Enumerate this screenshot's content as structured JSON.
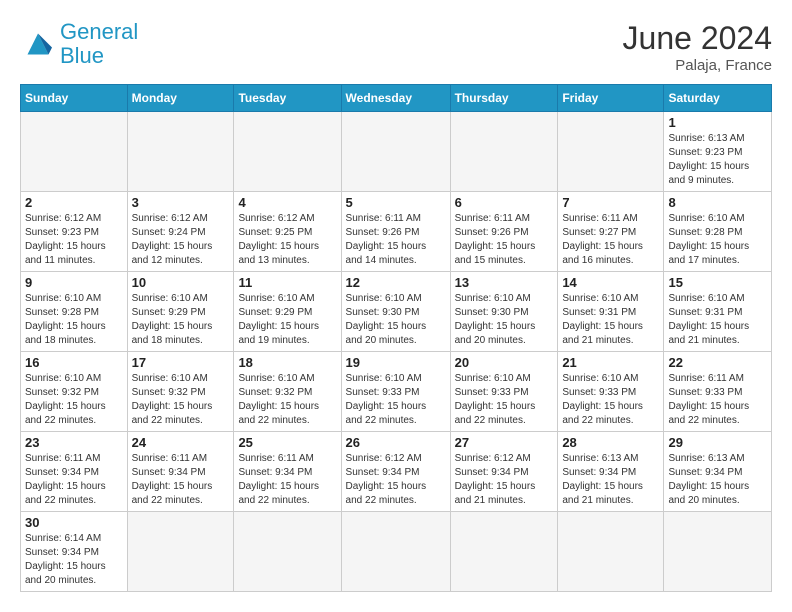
{
  "header": {
    "logo_general": "General",
    "logo_blue": "Blue",
    "month_year": "June 2024",
    "location": "Palaja, France"
  },
  "days_of_week": [
    "Sunday",
    "Monday",
    "Tuesday",
    "Wednesday",
    "Thursday",
    "Friday",
    "Saturday"
  ],
  "weeks": [
    [
      {
        "day": "",
        "info": ""
      },
      {
        "day": "",
        "info": ""
      },
      {
        "day": "",
        "info": ""
      },
      {
        "day": "",
        "info": ""
      },
      {
        "day": "",
        "info": ""
      },
      {
        "day": "",
        "info": ""
      },
      {
        "day": "1",
        "info": "Sunrise: 6:13 AM\nSunset: 9:23 PM\nDaylight: 15 hours\nand 9 minutes."
      }
    ],
    [
      {
        "day": "2",
        "info": "Sunrise: 6:12 AM\nSunset: 9:23 PM\nDaylight: 15 hours\nand 11 minutes."
      },
      {
        "day": "3",
        "info": "Sunrise: 6:12 AM\nSunset: 9:24 PM\nDaylight: 15 hours\nand 12 minutes."
      },
      {
        "day": "4",
        "info": "Sunrise: 6:12 AM\nSunset: 9:25 PM\nDaylight: 15 hours\nand 13 minutes."
      },
      {
        "day": "5",
        "info": "Sunrise: 6:11 AM\nSunset: 9:26 PM\nDaylight: 15 hours\nand 14 minutes."
      },
      {
        "day": "6",
        "info": "Sunrise: 6:11 AM\nSunset: 9:26 PM\nDaylight: 15 hours\nand 15 minutes."
      },
      {
        "day": "7",
        "info": "Sunrise: 6:11 AM\nSunset: 9:27 PM\nDaylight: 15 hours\nand 16 minutes."
      },
      {
        "day": "8",
        "info": "Sunrise: 6:10 AM\nSunset: 9:28 PM\nDaylight: 15 hours\nand 17 minutes."
      }
    ],
    [
      {
        "day": "9",
        "info": "Sunrise: 6:10 AM\nSunset: 9:28 PM\nDaylight: 15 hours\nand 18 minutes."
      },
      {
        "day": "10",
        "info": "Sunrise: 6:10 AM\nSunset: 9:29 PM\nDaylight: 15 hours\nand 18 minutes."
      },
      {
        "day": "11",
        "info": "Sunrise: 6:10 AM\nSunset: 9:29 PM\nDaylight: 15 hours\nand 19 minutes."
      },
      {
        "day": "12",
        "info": "Sunrise: 6:10 AM\nSunset: 9:30 PM\nDaylight: 15 hours\nand 20 minutes."
      },
      {
        "day": "13",
        "info": "Sunrise: 6:10 AM\nSunset: 9:30 PM\nDaylight: 15 hours\nand 20 minutes."
      },
      {
        "day": "14",
        "info": "Sunrise: 6:10 AM\nSunset: 9:31 PM\nDaylight: 15 hours\nand 21 minutes."
      },
      {
        "day": "15",
        "info": "Sunrise: 6:10 AM\nSunset: 9:31 PM\nDaylight: 15 hours\nand 21 minutes."
      }
    ],
    [
      {
        "day": "16",
        "info": "Sunrise: 6:10 AM\nSunset: 9:32 PM\nDaylight: 15 hours\nand 22 minutes."
      },
      {
        "day": "17",
        "info": "Sunrise: 6:10 AM\nSunset: 9:32 PM\nDaylight: 15 hours\nand 22 minutes."
      },
      {
        "day": "18",
        "info": "Sunrise: 6:10 AM\nSunset: 9:32 PM\nDaylight: 15 hours\nand 22 minutes."
      },
      {
        "day": "19",
        "info": "Sunrise: 6:10 AM\nSunset: 9:33 PM\nDaylight: 15 hours\nand 22 minutes."
      },
      {
        "day": "20",
        "info": "Sunrise: 6:10 AM\nSunset: 9:33 PM\nDaylight: 15 hours\nand 22 minutes."
      },
      {
        "day": "21",
        "info": "Sunrise: 6:10 AM\nSunset: 9:33 PM\nDaylight: 15 hours\nand 22 minutes."
      },
      {
        "day": "22",
        "info": "Sunrise: 6:11 AM\nSunset: 9:33 PM\nDaylight: 15 hours\nand 22 minutes."
      }
    ],
    [
      {
        "day": "23",
        "info": "Sunrise: 6:11 AM\nSunset: 9:34 PM\nDaylight: 15 hours\nand 22 minutes."
      },
      {
        "day": "24",
        "info": "Sunrise: 6:11 AM\nSunset: 9:34 PM\nDaylight: 15 hours\nand 22 minutes."
      },
      {
        "day": "25",
        "info": "Sunrise: 6:11 AM\nSunset: 9:34 PM\nDaylight: 15 hours\nand 22 minutes."
      },
      {
        "day": "26",
        "info": "Sunrise: 6:12 AM\nSunset: 9:34 PM\nDaylight: 15 hours\nand 22 minutes."
      },
      {
        "day": "27",
        "info": "Sunrise: 6:12 AM\nSunset: 9:34 PM\nDaylight: 15 hours\nand 21 minutes."
      },
      {
        "day": "28",
        "info": "Sunrise: 6:13 AM\nSunset: 9:34 PM\nDaylight: 15 hours\nand 21 minutes."
      },
      {
        "day": "29",
        "info": "Sunrise: 6:13 AM\nSunset: 9:34 PM\nDaylight: 15 hours\nand 20 minutes."
      }
    ],
    [
      {
        "day": "30",
        "info": "Sunrise: 6:14 AM\nSunset: 9:34 PM\nDaylight: 15 hours\nand 20 minutes."
      },
      {
        "day": "",
        "info": ""
      },
      {
        "day": "",
        "info": ""
      },
      {
        "day": "",
        "info": ""
      },
      {
        "day": "",
        "info": ""
      },
      {
        "day": "",
        "info": ""
      },
      {
        "day": "",
        "info": ""
      }
    ]
  ]
}
